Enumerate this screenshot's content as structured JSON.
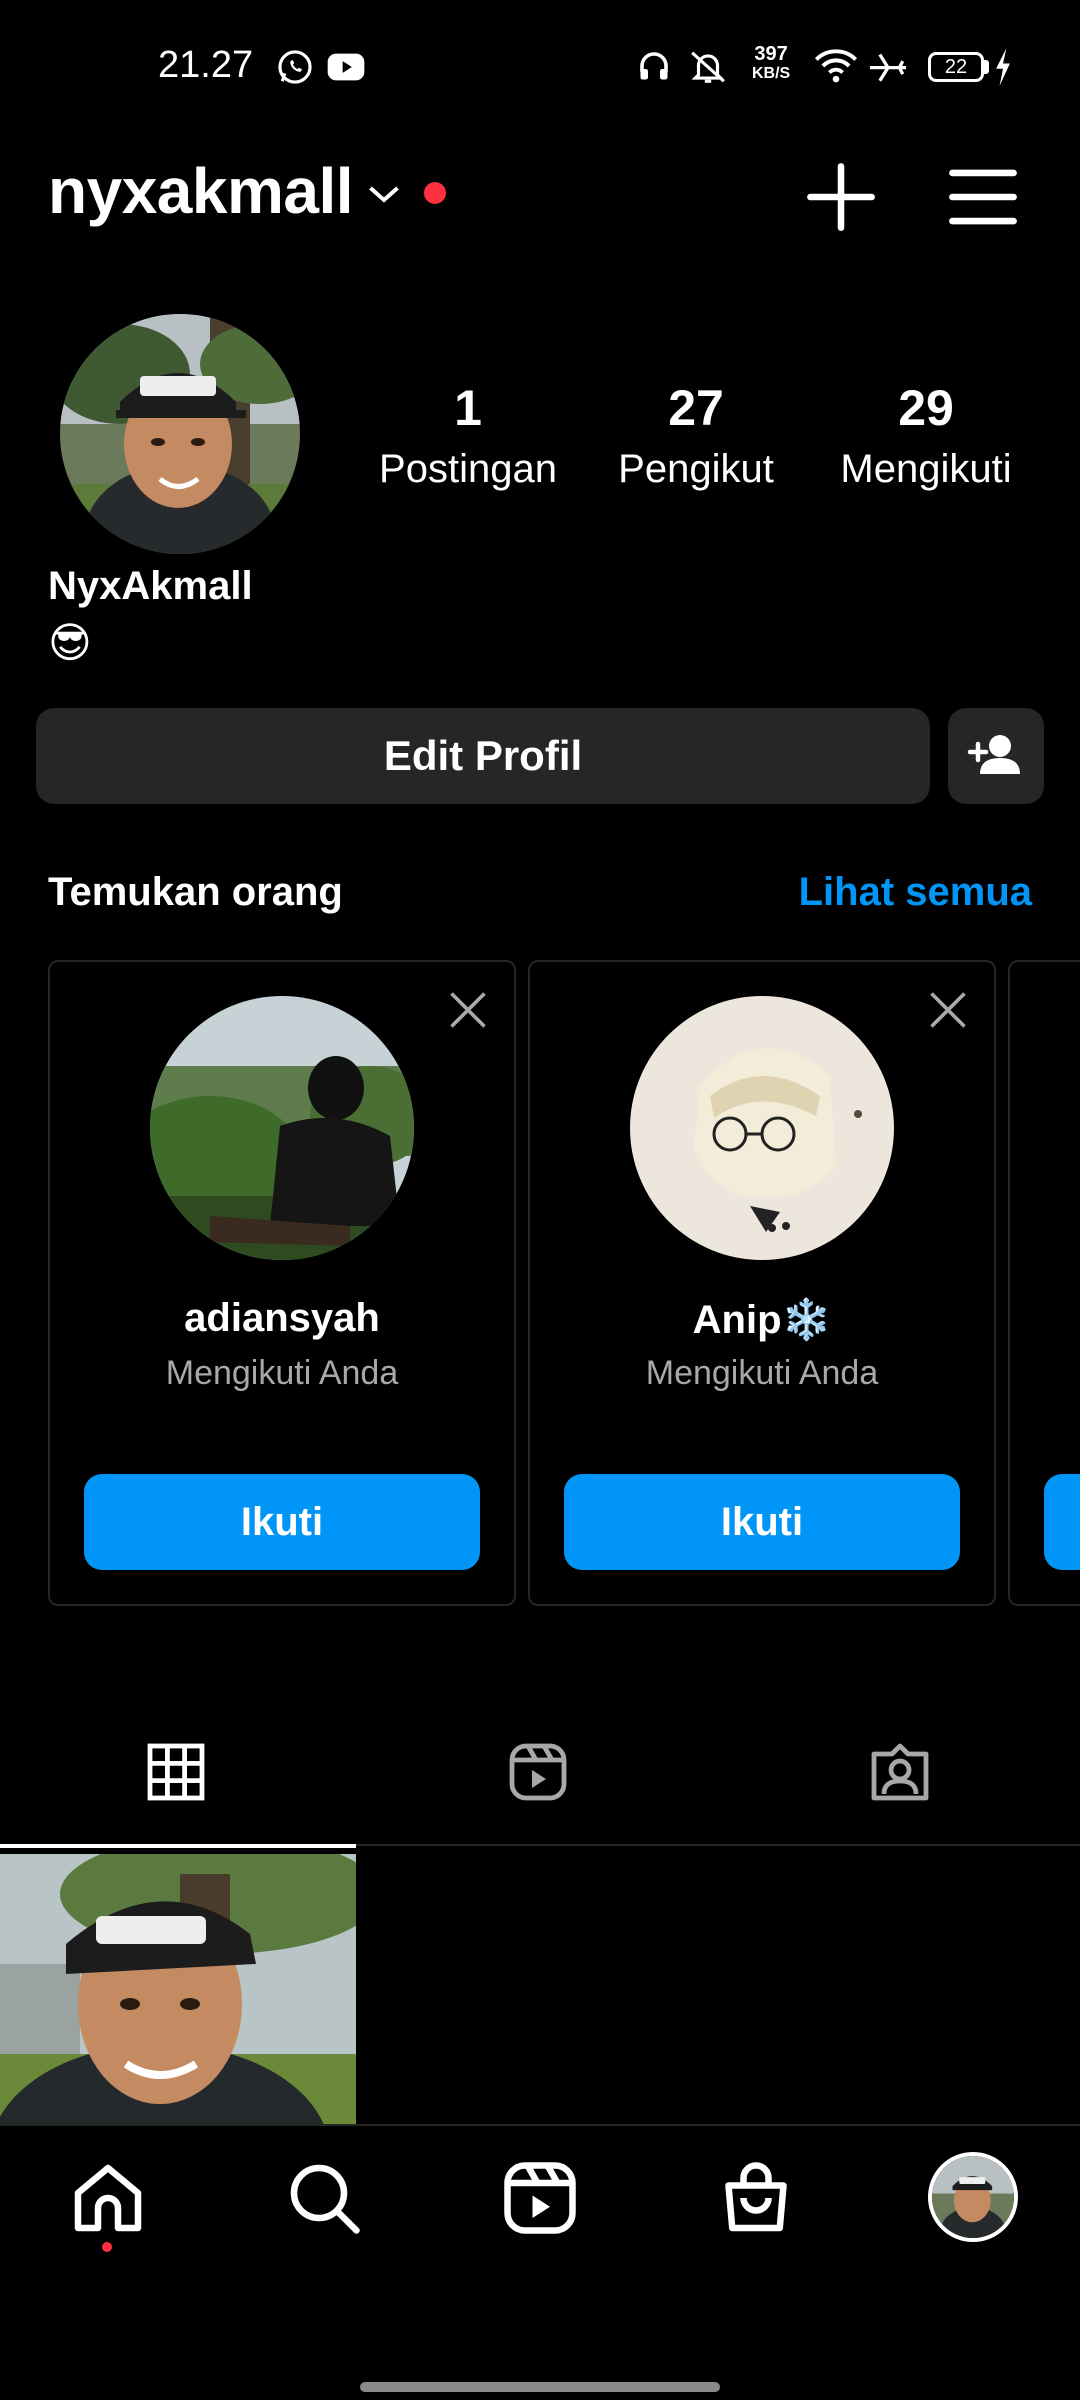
{
  "status_bar": {
    "time": "21.27",
    "net_speed_value": "397",
    "net_speed_unit": "KB/S",
    "battery_level": "22"
  },
  "header": {
    "username": "nyxakmall"
  },
  "profile": {
    "stats": [
      {
        "value": "1",
        "label": "Postingan"
      },
      {
        "value": "27",
        "label": "Pengikut"
      },
      {
        "value": "29",
        "label": "Mengikuti"
      }
    ],
    "display_name": "NyxAkmall",
    "bio": "😎",
    "edit_label": "Edit Profil"
  },
  "discover": {
    "title": "Temukan orang",
    "see_all": "Lihat semua",
    "cards": [
      {
        "name": "adiansyah",
        "subtitle": "Mengikuti Anda",
        "button": "Ikuti"
      },
      {
        "name": "Anip❄️",
        "subtitle": "Mengikuti Anda",
        "button": "Ikuti"
      }
    ]
  },
  "tabs": [
    "grid-icon",
    "reels-icon",
    "tagged-icon"
  ],
  "bottom_nav": [
    "home-icon",
    "search-icon",
    "reels-icon",
    "shop-icon",
    "profile-avatar"
  ],
  "colors": {
    "accent": "#0095f6",
    "notification": "#ff3040",
    "surface": "#262626",
    "background": "#000000"
  }
}
